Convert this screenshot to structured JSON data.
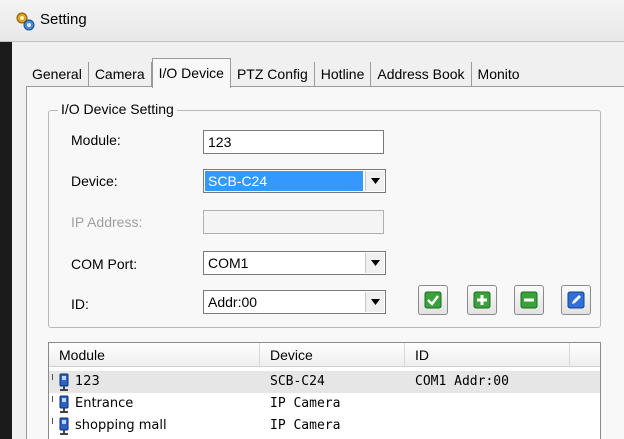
{
  "window": {
    "title": "Setting",
    "title_icon": "app-settings-icon"
  },
  "tabs": [
    {
      "label": "General"
    },
    {
      "label": "Camera"
    },
    {
      "label": "I/O Device",
      "active": true
    },
    {
      "label": "PTZ Config"
    },
    {
      "label": "Hotline"
    },
    {
      "label": "Address Book"
    },
    {
      "label": "Monito"
    }
  ],
  "io_setting": {
    "group_label": "I/O Device Setting",
    "module_label": "Module:",
    "module_value": "123",
    "device_label": "Device:",
    "device_value": "SCB-C24",
    "ip_label": "IP Address:",
    "ip_value": "",
    "com_label": "COM Port:",
    "com_value": "COM1",
    "id_label": "ID:",
    "id_value": "Addr:00",
    "buttons": [
      {
        "icon": "check-icon",
        "color": "#3aa23a"
      },
      {
        "icon": "plus-icon",
        "color": "#3aa23a"
      },
      {
        "icon": "minus-icon",
        "color": "#3aa23a"
      },
      {
        "icon": "edit-icon",
        "color": "#2f6fd6"
      }
    ]
  },
  "device_list": {
    "columns": [
      "Module",
      "Device",
      "ID"
    ],
    "rows": [
      {
        "module": "123",
        "device": "SCB-C24",
        "id": "COM1 Addr:00",
        "selected": true,
        "icon": "device-icon"
      },
      {
        "module": "Entrance",
        "device": "IP Camera",
        "id": "",
        "selected": false,
        "icon": "device-icon"
      },
      {
        "module": "shopping mall",
        "device": "IP Camera",
        "id": "",
        "selected": false,
        "icon": "device-icon"
      }
    ]
  }
}
